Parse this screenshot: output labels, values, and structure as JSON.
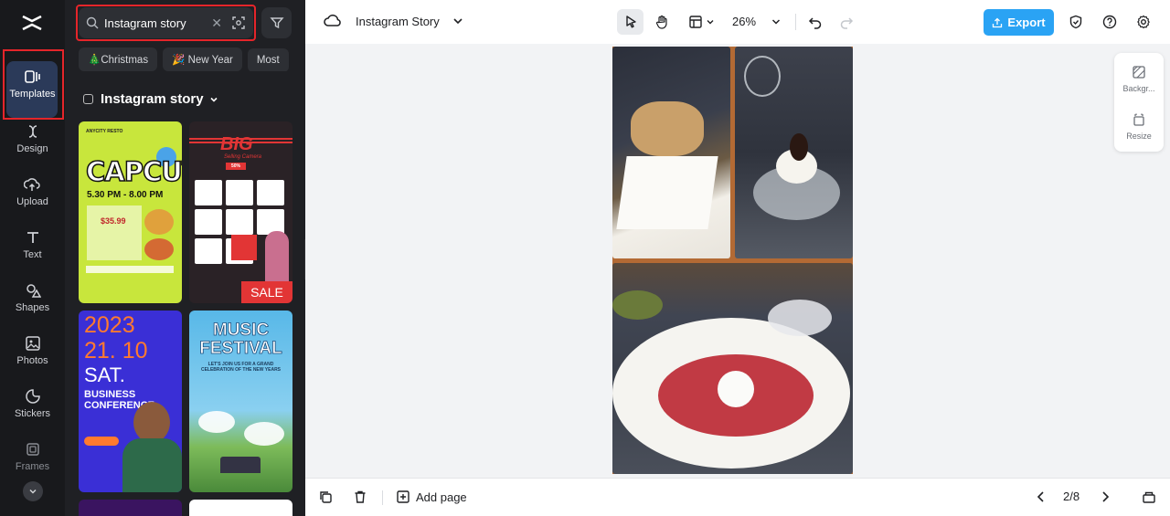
{
  "rail": {
    "items": [
      {
        "label": "Templates",
        "icon": "templates-icon"
      },
      {
        "label": "Design",
        "icon": "design-icon"
      },
      {
        "label": "Upload",
        "icon": "upload-icon"
      },
      {
        "label": "Text",
        "icon": "text-icon"
      },
      {
        "label": "Shapes",
        "icon": "shapes-icon"
      },
      {
        "label": "Photos",
        "icon": "photos-icon"
      },
      {
        "label": "Stickers",
        "icon": "stickers-icon"
      },
      {
        "label": "Frames",
        "icon": "frames-icon"
      }
    ]
  },
  "panel": {
    "search_value": "Instagram story",
    "chips": [
      "🎄Christmas",
      "🎉 New Year",
      "Most"
    ],
    "section_title": "Instagram story",
    "templates": {
      "t1": {
        "top": "ANYCITY RESTO",
        "title": "CAPCUT",
        "time": "5.30 PM - 8.00 PM",
        "price": "$35.99"
      },
      "t2": {
        "title": "BIG",
        "sub": "Selling Camera",
        "badge": "50%",
        "sale": "SALE"
      },
      "t3": {
        "year": "2023",
        "date": "21. 10",
        "day": "SAT.",
        "title1": "BUSINESS",
        "title2": "CONFERENCE"
      },
      "t4": {
        "title1": "MUSIC",
        "title2": "FESTIVAL",
        "sub": "LET'S JOIN US FOR A GRAND CELEBRATION OF THE NEW YEARS"
      }
    }
  },
  "topbar": {
    "doc_name": "Instagram Story",
    "zoom": "26%",
    "export_label": "Export"
  },
  "side_tools": {
    "background_label": "Backgr...",
    "resize_label": "Resize"
  },
  "bottombar": {
    "add_page_label": "Add page",
    "page_indicator": "2/8"
  },
  "colors": {
    "accent": "#2aa3f4",
    "highlight": "#e5252a",
    "rail_bg": "#18191c",
    "panel_bg": "#1f2024"
  }
}
